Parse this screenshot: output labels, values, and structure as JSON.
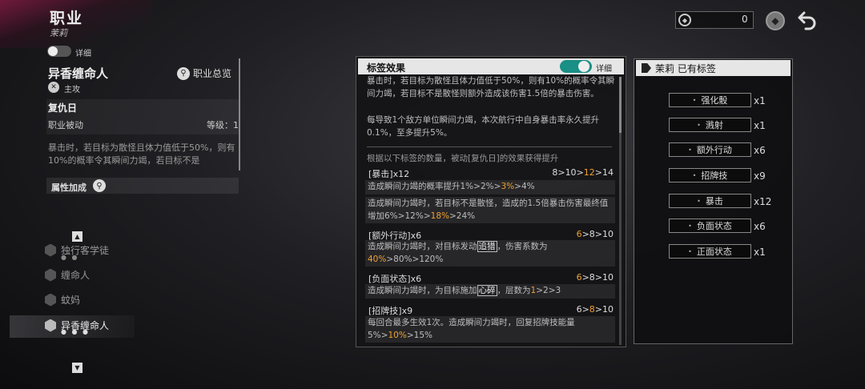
{
  "header": {
    "title": "职业",
    "subtitle": "茉莉",
    "coin_value": "0",
    "tag_button_icon": "tag-icon",
    "back_button_icon": "back-arrow-icon"
  },
  "left": {
    "detail_toggle_label": "详细",
    "class_name": "异香缠命人",
    "role": "主攻",
    "overview_label": "职业总览",
    "skill_name": "复仇日",
    "skill_type": "职业被动",
    "skill_level": "等级：1",
    "skill_desc": "暴击时，若目标为散怪且体力值低于50%，则有10%的概率令其瞬间力竭，若目标不是",
    "attr_label": "属性加成"
  },
  "class_list": [
    {
      "name": "独行客学徒",
      "dots": "● ●"
    },
    {
      "name": "缠命人",
      "dots": ""
    },
    {
      "name": "蚊妈",
      "dots": ""
    },
    {
      "name": "异香缠命人",
      "dots": "● ● ●"
    }
  ],
  "center": {
    "title": "标签效果",
    "detail_toggle_label": "详细",
    "main_desc": "暴击时，若目标为散怪且体力值低于50%，则有10%的概率令其瞬间力竭，若目标不是散怪则额外造成该伤害1.5倍的暴击伤害。",
    "sub_desc": "每导致1个敌方单位瞬间力竭，本次航行中自身暴击率永久提升0.1%，至多提升5%。",
    "boost_intro": "根据以下标签的数量，被动[复仇日]的效果获得提升",
    "tags": [
      {
        "name": "[暴击]x12",
        "thresholds": {
          "a": "8",
          "b": "10",
          "c": "12",
          "d": "14"
        },
        "desc1": {
          "pre": "造成瞬间力竭的概率提升",
          "v1": "1%",
          "v2": "2%",
          "v3": "3%",
          "v4": "4%"
        },
        "desc2": {
          "pre": "造成瞬间力竭时，若目标不是散怪，造成的1.5倍暴击伤害最终值增加",
          "v1": "6%",
          "v2": "12%",
          "v3": "18%",
          "v4": "24%"
        }
      },
      {
        "name": "[额外行动]x6",
        "thresholds": {
          "a": "6",
          "b": "8",
          "c": "10"
        },
        "desc": {
          "pre": "造成瞬间力竭时，对目标发动",
          "kw": "追猎",
          "mid": "，伤害系数为",
          "v1": "40%",
          "v2": "80%",
          "v3": "120%"
        }
      },
      {
        "name": "[负面状态]x6",
        "thresholds": {
          "a": "6",
          "b": "8",
          "c": "10"
        },
        "desc": {
          "pre": "造成瞬间力竭时，为目标施加",
          "kw": "心碎",
          "mid": "，层数为",
          "v1": "1",
          "v2": "2",
          "v3": "3"
        }
      },
      {
        "name": "[招牌技]x9",
        "thresholds": {
          "a": "6",
          "b": "8",
          "c": "10"
        },
        "desc": {
          "pre": "每回合最多生效1次。造成瞬间力竭时，回复招牌技能量",
          "v1": "5%",
          "v2": "10%",
          "v3": "15%"
        }
      }
    ],
    "highlight_color": "#f0a030"
  },
  "right": {
    "title": "茉莉 已有标签",
    "owned": [
      {
        "label": "强化骰",
        "count": "x1"
      },
      {
        "label": "溅射",
        "count": "x1"
      },
      {
        "label": "额外行动",
        "count": "x6"
      },
      {
        "label": "招牌技",
        "count": "x9"
      },
      {
        "label": "暴击",
        "count": "x12"
      },
      {
        "label": "负面状态",
        "count": "x6"
      },
      {
        "label": "正面状态",
        "count": "x1"
      }
    ]
  }
}
